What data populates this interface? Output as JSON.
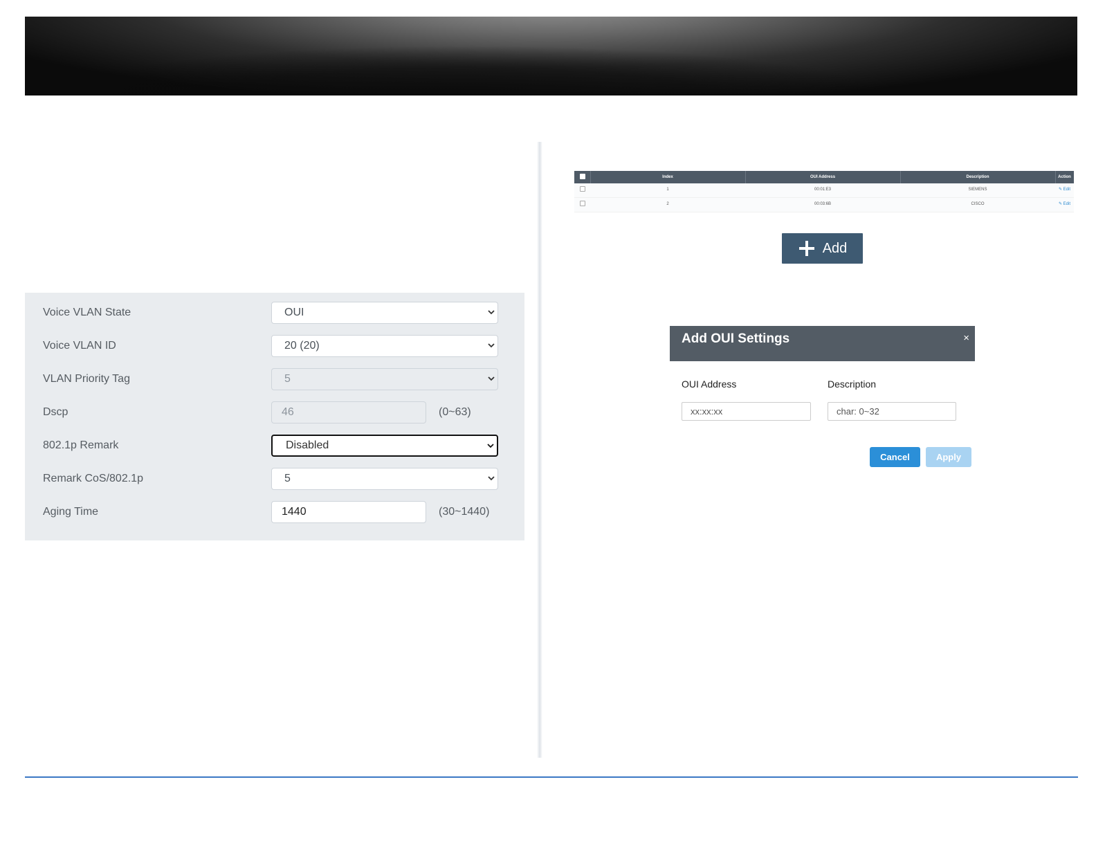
{
  "settings": {
    "rows": [
      {
        "label": "Voice VLAN State",
        "value": "OUI",
        "type": "select"
      },
      {
        "label": "Voice VLAN ID",
        "value": "20 (20)",
        "type": "select"
      },
      {
        "label": "VLAN Priority Tag",
        "value": "5",
        "type": "select",
        "disabled": true
      },
      {
        "label": "Dscp",
        "value": "46",
        "type": "input",
        "disabled": true,
        "range": "(0~63)"
      },
      {
        "label": "802.1p Remark",
        "value": "Disabled",
        "type": "select",
        "focused": true
      },
      {
        "label": "Remark CoS/802.1p",
        "value": "5",
        "type": "select"
      },
      {
        "label": "Aging Time",
        "value": "1440",
        "type": "input",
        "range": "(30~1440)"
      }
    ]
  },
  "oui_table": {
    "headers": [
      "Index",
      "OUI Address",
      "Description",
      "Action"
    ],
    "rows": [
      {
        "index": "1",
        "oui": "00:01:E3",
        "description": "SIEMENS",
        "action": "Edit"
      },
      {
        "index": "2",
        "oui": "00:03:6B",
        "description": "CISCO",
        "action": "Edit"
      }
    ]
  },
  "add_button": {
    "label": "Add",
    "icon": "plus-icon"
  },
  "modal": {
    "title": "Add OUI Settings",
    "close": "×",
    "oui_label": "OUI Address",
    "oui_placeholder": "xx:xx:xx",
    "desc_label": "Description",
    "desc_placeholder": "char: 0~32",
    "cancel_label": "Cancel",
    "apply_label": "Apply"
  },
  "colors": {
    "header_bar": "#4e5a66",
    "add_button": "#3e5a72",
    "cancel_button": "#2b8fd8",
    "apply_button_disabled": "#a9d3f2",
    "footer_line": "#3b78c4"
  }
}
